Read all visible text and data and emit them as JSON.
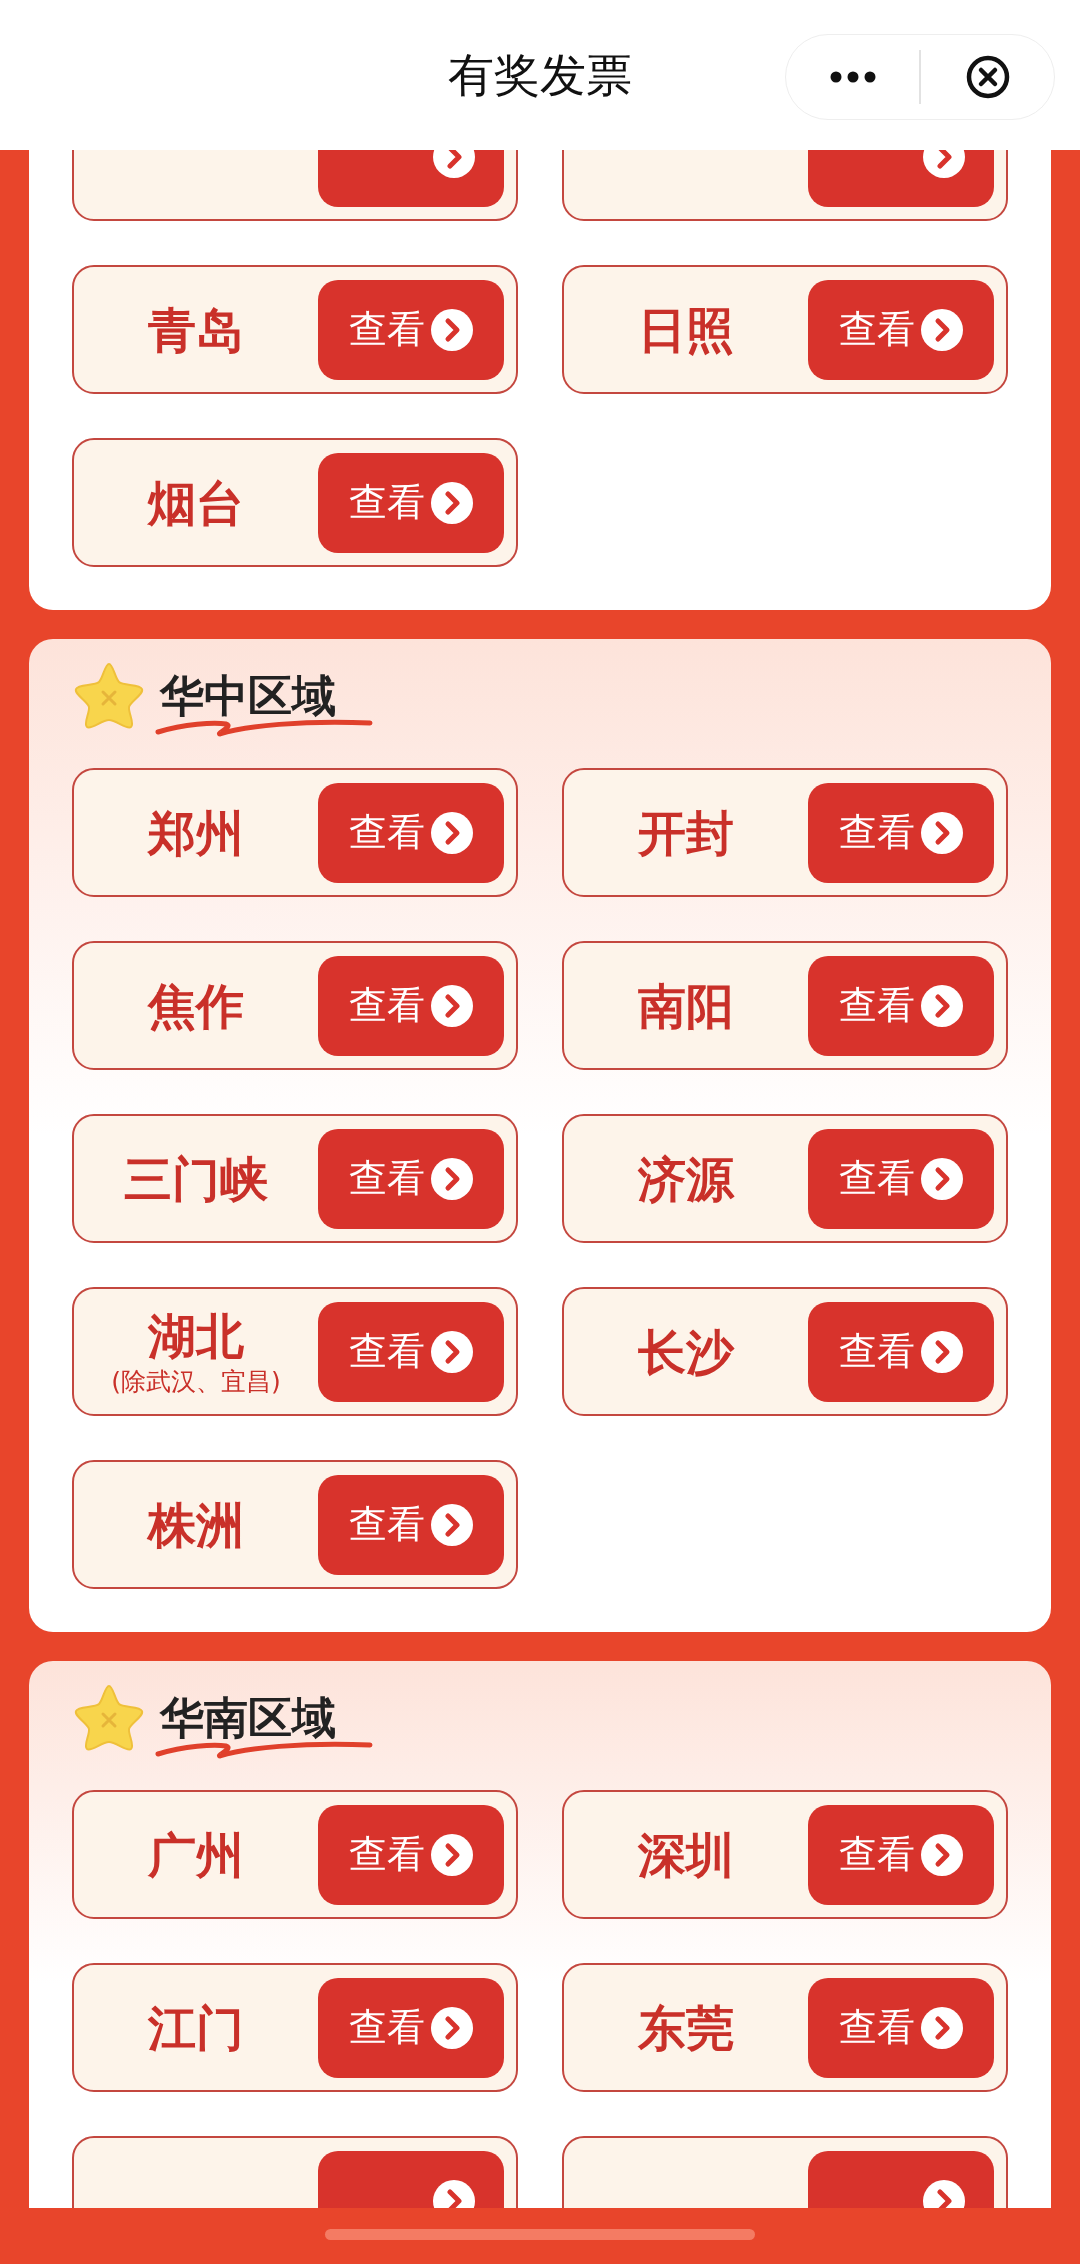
{
  "header": {
    "title": "有奖发票"
  },
  "sections": [
    {
      "cities": [
        {
          "kind": "partial"
        },
        {
          "kind": "partial"
        },
        {
          "name": "青岛",
          "button": "查看"
        },
        {
          "name": "日照",
          "button": "查看"
        },
        {
          "name": "烟台",
          "button": "查看"
        }
      ]
    },
    {
      "title": "华中区域",
      "cities": [
        {
          "name": "郑州",
          "button": "查看"
        },
        {
          "name": "开封",
          "button": "查看"
        },
        {
          "name": "焦作",
          "button": "查看"
        },
        {
          "name": "南阳",
          "button": "查看"
        },
        {
          "name": "三门峡",
          "button": "查看"
        },
        {
          "name": "济源",
          "button": "查看"
        },
        {
          "name": "湖北",
          "note": "(除武汉、宜昌)",
          "button": "查看"
        },
        {
          "name": "长沙",
          "button": "查看"
        },
        {
          "name": "株洲",
          "button": "查看"
        }
      ]
    },
    {
      "title": "华南区域",
      "cities": [
        {
          "name": "广州",
          "button": "查看"
        },
        {
          "name": "深圳",
          "button": "查看"
        },
        {
          "name": "江门",
          "button": "查看"
        },
        {
          "name": "东莞",
          "button": "查看"
        },
        {
          "kind": "partial"
        },
        {
          "kind": "partial"
        }
      ]
    }
  ]
}
